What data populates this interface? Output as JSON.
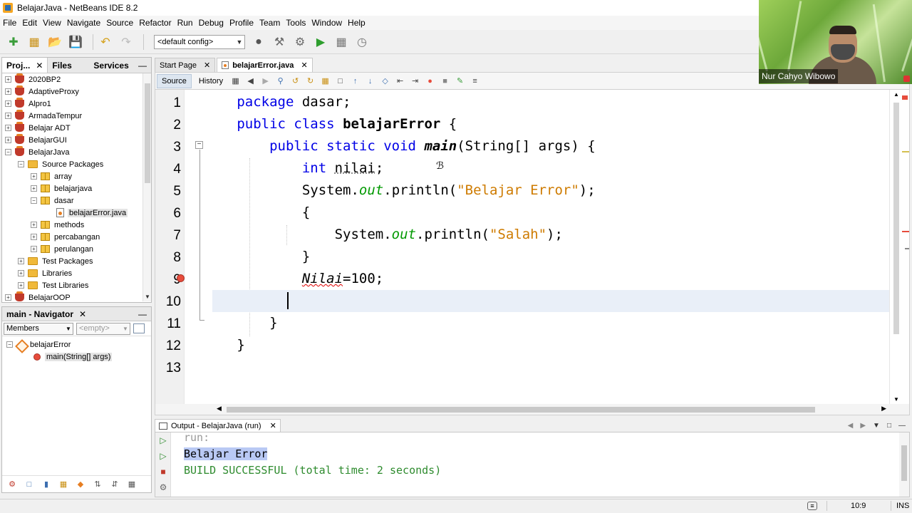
{
  "window": {
    "title": "BelajarJava - NetBeans IDE 8.2"
  },
  "menu": [
    "File",
    "Edit",
    "View",
    "Navigate",
    "Source",
    "Refactor",
    "Run",
    "Debug",
    "Profile",
    "Team",
    "Tools",
    "Window",
    "Help"
  ],
  "toolbar": {
    "config": "<default config>"
  },
  "project_panel": {
    "tabs": [
      "Proj...",
      "Files",
      "Services"
    ],
    "tree": [
      {
        "label": "2020BP2",
        "type": "project",
        "level": 0,
        "expanded": false
      },
      {
        "label": "AdaptiveProxy",
        "type": "project",
        "level": 0,
        "expanded": false
      },
      {
        "label": "Alpro1",
        "type": "project",
        "level": 0,
        "expanded": false
      },
      {
        "label": "ArmadaTempur",
        "type": "project",
        "level": 0,
        "expanded": false
      },
      {
        "label": "Belajar ADT",
        "type": "project",
        "level": 0,
        "expanded": false
      },
      {
        "label": "BelajarGUI",
        "type": "project",
        "level": 0,
        "expanded": false
      },
      {
        "label": "BelajarJava",
        "type": "project",
        "level": 0,
        "expanded": true
      },
      {
        "label": "Source Packages",
        "type": "folder",
        "level": 1,
        "expanded": true
      },
      {
        "label": "array",
        "type": "package",
        "level": 2,
        "expanded": false
      },
      {
        "label": "belajarjava",
        "type": "package",
        "level": 2,
        "expanded": false
      },
      {
        "label": "dasar",
        "type": "package",
        "level": 2,
        "expanded": true
      },
      {
        "label": "belajarError.java",
        "type": "file",
        "level": 3,
        "selected": true
      },
      {
        "label": "methods",
        "type": "package",
        "level": 2,
        "expanded": false
      },
      {
        "label": "percabangan",
        "type": "package",
        "level": 2,
        "expanded": false
      },
      {
        "label": "perulangan",
        "type": "package",
        "level": 2,
        "expanded": false
      },
      {
        "label": "Test Packages",
        "type": "folder",
        "level": 1,
        "expanded": false
      },
      {
        "label": "Libraries",
        "type": "folder",
        "level": 1,
        "expanded": false
      },
      {
        "label": "Test Libraries",
        "type": "folder",
        "level": 1,
        "expanded": false
      },
      {
        "label": "BelajarOOP",
        "type": "project",
        "level": 0,
        "expanded": false
      }
    ]
  },
  "navigator": {
    "title": "main - Navigator",
    "filter": "Members",
    "filter2": "<empty>",
    "tree": [
      {
        "label": "belajarError",
        "type": "class"
      },
      {
        "label": "main(String[] args)",
        "type": "method"
      }
    ]
  },
  "editor": {
    "tabs": [
      "Start Page",
      "belajarError.java"
    ],
    "active_tab": "belajarError.java",
    "modes": [
      "Source",
      "History"
    ],
    "lines": [
      {
        "n": "1"
      },
      {
        "n": "2"
      },
      {
        "n": "3"
      },
      {
        "n": "4"
      },
      {
        "n": "5"
      },
      {
        "n": "6"
      },
      {
        "n": "7"
      },
      {
        "n": "8"
      },
      {
        "n": "9"
      },
      {
        "n": "10"
      },
      {
        "n": "11"
      },
      {
        "n": "12"
      },
      {
        "n": "13"
      }
    ],
    "code": {
      "l1_kw": "package",
      "l1_rest": " dasar;",
      "l2_kw1": "public",
      "l2_kw2": "class",
      "l2_name": "belajarError",
      "l2_rest": " {",
      "l3_kw": "public static void",
      "l3_name": "main",
      "l3_rest": "(String[] args) {",
      "l4_kw": "int",
      "l4_var": "nilai",
      "l4_rest": ";",
      "l5_a": "System.",
      "l5_fld": "out",
      "l5_b": ".println(",
      "l5_str": "\"Belajar Error\"",
      "l5_c": ");",
      "l6": "{",
      "l7_a": "System.",
      "l7_fld": "out",
      "l7_b": ".println(",
      "l7_str": "\"Salah\"",
      "l7_c": ");",
      "l8": "}",
      "l9_err": "Nilai",
      "l9_rest": "=100;",
      "l11": "}",
      "l12": "}"
    }
  },
  "output": {
    "tab": "Output - BelajarJava (run)",
    "lines": [
      "run:",
      "Belajar Error",
      "BUILD SUCCESSFUL (total time: 2 seconds)"
    ]
  },
  "status": {
    "position": "10:9",
    "mode": "INS"
  },
  "webcam": {
    "name": "Nur Cahyo Wibowo"
  }
}
